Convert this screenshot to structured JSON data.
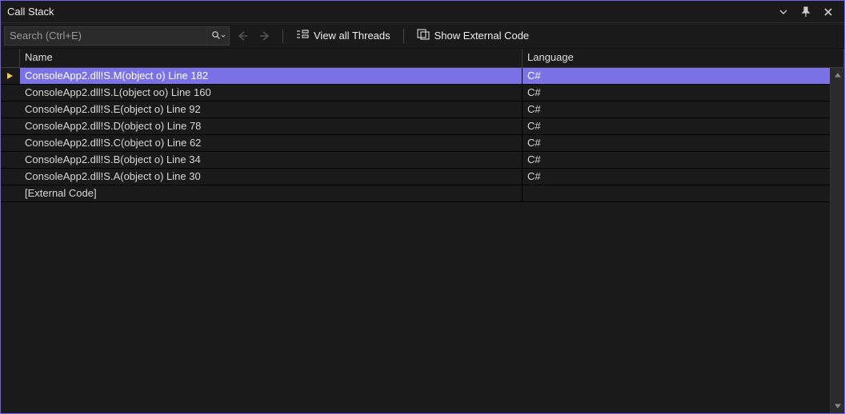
{
  "window": {
    "title": "Call Stack"
  },
  "toolbar": {
    "search_placeholder": "Search (Ctrl+E)",
    "view_all_threads_label": "View all Threads",
    "show_external_code_label": "Show External Code"
  },
  "columns": {
    "name": "Name",
    "language": "Language"
  },
  "frames": [
    {
      "name": "ConsoleApp2.dll!S.M(object o) Line 182",
      "language": "C#",
      "current": true
    },
    {
      "name": "ConsoleApp2.dll!S.L(object oo) Line 160",
      "language": "C#",
      "current": false
    },
    {
      "name": "ConsoleApp2.dll!S.E(object o) Line 92",
      "language": "C#",
      "current": false
    },
    {
      "name": "ConsoleApp2.dll!S.D(object o) Line 78",
      "language": "C#",
      "current": false
    },
    {
      "name": "ConsoleApp2.dll!S.C(object o) Line 62",
      "language": "C#",
      "current": false
    },
    {
      "name": "ConsoleApp2.dll!S.B(object o) Line 34",
      "language": "C#",
      "current": false
    },
    {
      "name": "ConsoleApp2.dll!S.A(object o) Line 30",
      "language": "C#",
      "current": false
    },
    {
      "name": "[External Code]",
      "language": "",
      "current": false
    }
  ]
}
